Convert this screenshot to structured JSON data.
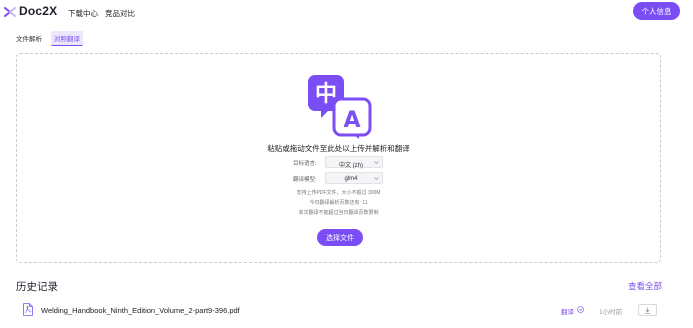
{
  "app": {
    "name": "Doc2X"
  },
  "nav": {
    "download_center": "下载中心",
    "competitor_compare": "竞品对比",
    "profile": "个人信息"
  },
  "tabs": [
    {
      "label": "文件解析"
    },
    {
      "label": "对照翻译"
    }
  ],
  "upload": {
    "headline": "粘贴或拖动文件至此处以上传并解析和翻译",
    "target_language_label": "目标语言:",
    "target_language_value": "中文 (zh)",
    "model_label": "翻译模型:",
    "model_value": "glm4",
    "note_1": "支持上传PDF文件，大小不超过 300M",
    "note_2": "今日翻译解析页数还有: 11",
    "note_3": "单次翻译不能超过当日翻译页数限制",
    "choose_button": "选择文件",
    "icon_glyph_left": "中",
    "icon_glyph_right": "A"
  },
  "history": {
    "title": "历史记录",
    "view_all": "查看全部",
    "items": [
      {
        "file": "Welding_Handbook_Ninth_Edition_Volume_2-part9-396.pdf",
        "status": "翻译",
        "time": "1小时前"
      }
    ]
  },
  "colors": {
    "accent": "#7b4ef5",
    "accent_light": "#ece6fb",
    "border": "#c9c9d4"
  },
  "icons": [
    "logo-icon",
    "translate-icon",
    "chevron-down-icon",
    "pdf-file-icon",
    "check-circle-icon",
    "download-icon"
  ]
}
